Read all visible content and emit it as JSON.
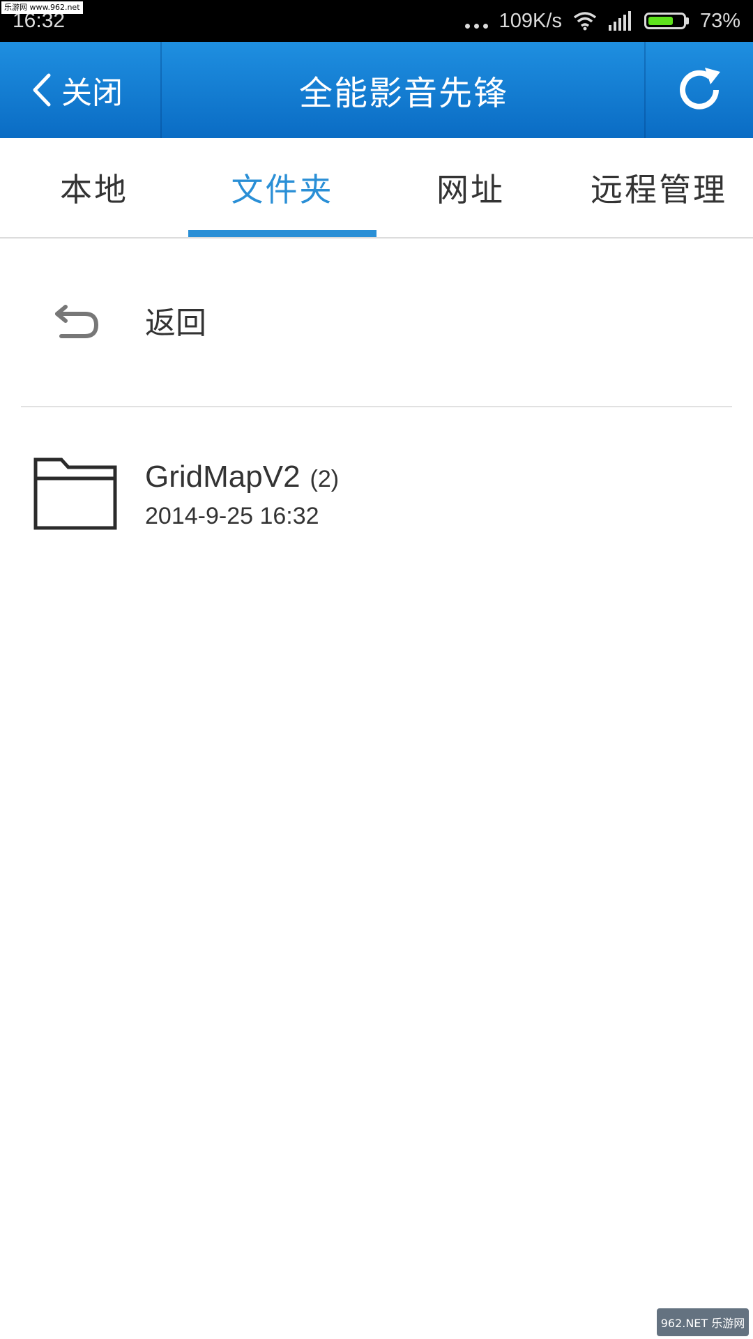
{
  "watermark": {
    "top_text": "乐游网 www.962.net",
    "bottom_text": "962.NET 乐游网"
  },
  "status_bar": {
    "time": "16:32",
    "net_speed": "109K/s",
    "battery_percent": "73%",
    "battery_level": 0.73,
    "battery_color": "#5ee21c"
  },
  "title_bar": {
    "close_label": "关闭",
    "title": "全能影音先锋",
    "refresh_icon": "refresh-icon",
    "background": "#0a6cc4"
  },
  "tabs": [
    {
      "label": "本地",
      "active": false
    },
    {
      "label": "文件夹",
      "active": true
    },
    {
      "label": "网址",
      "active": false
    },
    {
      "label": "远程管理",
      "active": false
    }
  ],
  "accent_color": "#2a8fd6",
  "file_list": {
    "back_label": "返回",
    "items": [
      {
        "name": "GridMapV2",
        "count": "(2)",
        "date": "2014-9-25 16:32",
        "icon": "folder-icon"
      }
    ]
  }
}
